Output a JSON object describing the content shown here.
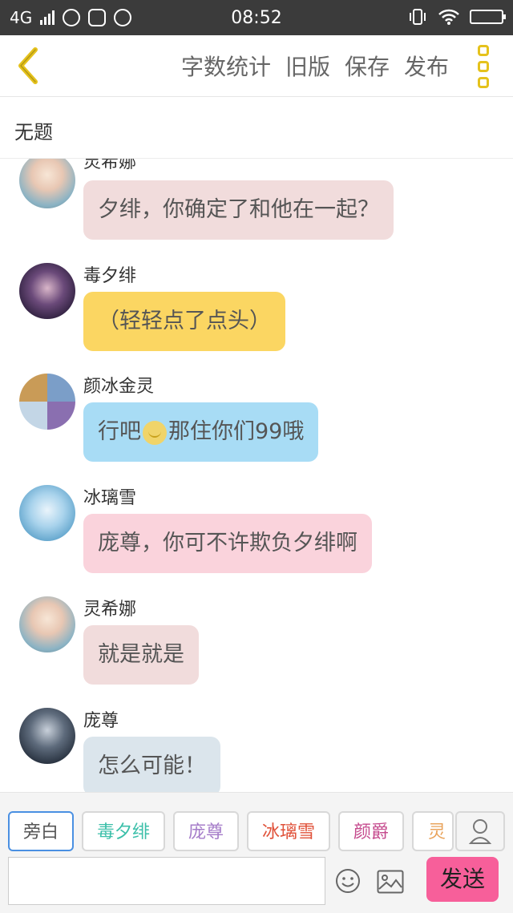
{
  "status_bar": {
    "network": "4G",
    "time": "08:52"
  },
  "toolbar": {
    "actions": [
      "字数统计",
      "旧版",
      "保存",
      "发布"
    ]
  },
  "title": "无题",
  "messages": [
    {
      "name": "灵希娜",
      "text": "夕绯，你确定了和他在一起？",
      "bubble_color": "#f1dcdc"
    },
    {
      "name": "毒夕绯",
      "text": "（轻轻点了点头）",
      "bubble_color": "#fbd662"
    },
    {
      "name": "颜冰金灵",
      "text_before": "行吧",
      "emoji": "smile-emoji",
      "text_after": "那住你们99哦",
      "bubble_color": "#a8dcf5"
    },
    {
      "name": "冰璃雪",
      "text": "庞尊，你可不许欺负夕绯啊",
      "bubble_color": "#fad3dc"
    },
    {
      "name": "灵希娜",
      "text": "就是就是",
      "bubble_color": "#f1dcdc"
    },
    {
      "name": "庞尊",
      "text": "怎么可能！",
      "bubble_color": "#dbe5ec"
    }
  ],
  "roles": [
    {
      "label": "旁白",
      "color": "#555555"
    },
    {
      "label": "毒夕绯",
      "color": "#3bbfa9"
    },
    {
      "label": "庞尊",
      "color": "#a57cc9"
    },
    {
      "label": "冰璃雪",
      "color": "#e0523a"
    },
    {
      "label": "颜爵",
      "color": "#c54a8d"
    },
    {
      "label": "灵希",
      "color": "#e9a35b"
    }
  ],
  "composer": {
    "input_value": "",
    "send_label": "发送"
  },
  "accent": {
    "more_icon": "#e5c21c",
    "send_button": "#f75f9a",
    "selected_chip_border": "#4a90e2"
  }
}
